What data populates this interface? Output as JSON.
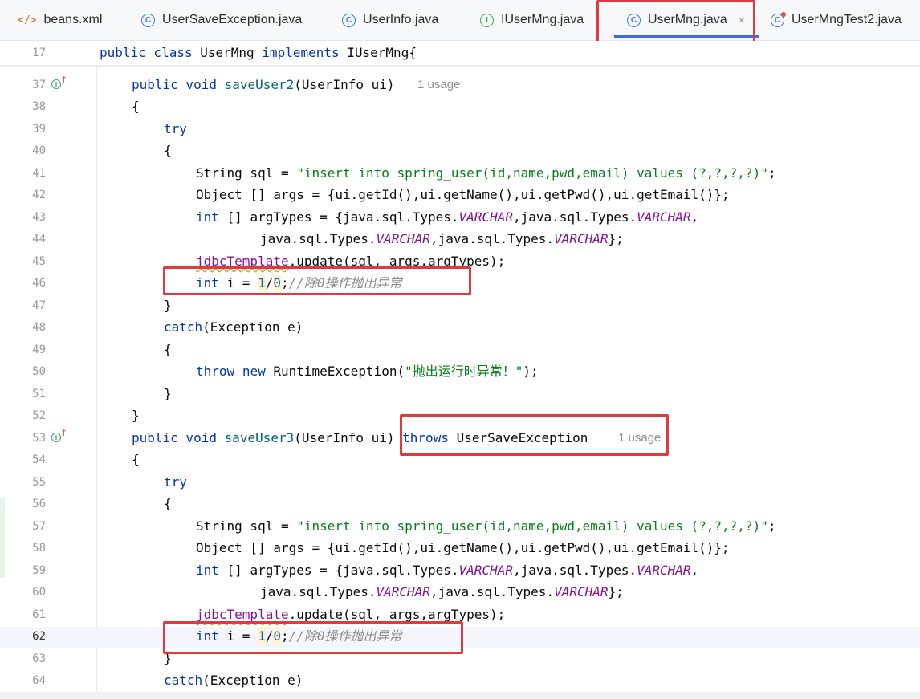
{
  "tabs": [
    {
      "label": "beans.xml",
      "icon": "xml-file-icon",
      "icon_glyph": "</>"
    },
    {
      "label": "UserSaveException.java",
      "icon": "class-icon",
      "icon_glyph": "C"
    },
    {
      "label": "UserInfo.java",
      "icon": "class-icon",
      "icon_glyph": "C"
    },
    {
      "label": "IUserMng.java",
      "icon": "interface-icon",
      "icon_glyph": "I"
    },
    {
      "label": "UserMng.java",
      "icon": "class-icon",
      "icon_glyph": "C",
      "active": true,
      "close": "×"
    },
    {
      "label": "UserMngTest2.java",
      "icon": "test-class-icon",
      "icon_glyph": "C"
    }
  ],
  "editor": {
    "sticky_line": {
      "number": "17",
      "text": "public class UserMng implements IUserMng{"
    },
    "line_numbers": [
      "37",
      "38",
      "39",
      "40",
      "41",
      "42",
      "43",
      "44",
      "45",
      "46",
      "47",
      "48",
      "49",
      "50",
      "51",
      "52",
      "53",
      "54",
      "55",
      "56",
      "57",
      "58",
      "59",
      "60",
      "61",
      "62",
      "63",
      "64"
    ],
    "current_line": "62",
    "inlay_hints": {
      "usage_1": "1 usage",
      "usage_2": "1 usage"
    },
    "gutter_marker": {
      "glyph": "I",
      "arrow": "↑"
    },
    "tokens": {
      "public_void": "public void ",
      "saveUser2": "saveUser2",
      "sig2_rest": "(UserInfo ui)",
      "saveUser3": "saveUser3",
      "sig3_rest": "(UserInfo ui) ",
      "throws": "throws",
      "throws_rest": " UserSaveException",
      "open_brace": "{",
      "close_brace": "}",
      "try": "try",
      "string_sql": "String sql = ",
      "sql_literal": "\"insert into spring_user(id,name,pwd,email) values (?,?,?,?)\"",
      "semicolon": ";",
      "object_args": "Object [] args = {ui.getId(),ui.getName(),ui.getPwd(),ui.getEmail()};",
      "int_kw": "int",
      "argtypes_decl": " [] argTypes = {java.sql.Types.",
      "comma_types": ",java.sql.Types.",
      "varchar": "VARCHAR",
      "cont_prefix": "java.sql.Types.",
      "comma": ",",
      "end_brace_semi": "};",
      "jdbc": "jdbcTemplate",
      "update_call": ".update(sql, args,argTypes);",
      "int_i_eq": " i = ",
      "one": "1",
      "slash": "/",
      "zero": "0",
      "div_comment": "//除0操作抛出异常",
      "catch": "catch",
      "catch_rest": "(Exception e)",
      "throw": "throw",
      "new": "new",
      "runtime_ex": " RuntimeException(",
      "runtime_msg": "\"抛出运行时异常！\"",
      "close_paren_semi": ");"
    }
  },
  "colors": {
    "keyword": "#0033b3",
    "string": "#067d17",
    "constant": "#871094",
    "method": "#00627a",
    "comment": "#8c8c8c",
    "number": "#1750eb",
    "highlight_box": "#e0393e",
    "active_tab_underline": "#3b6fe0"
  }
}
